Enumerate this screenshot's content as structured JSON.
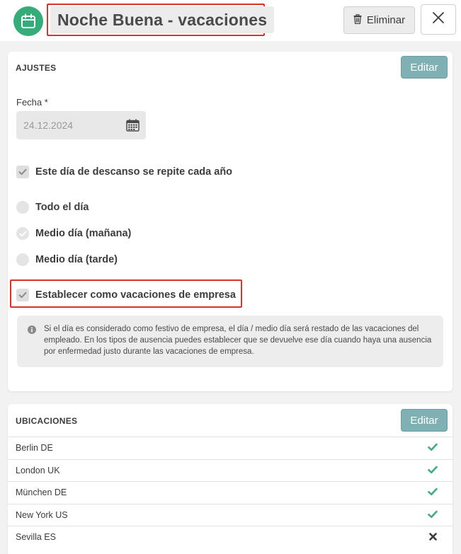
{
  "header": {
    "app_icon": "calendar-icon",
    "title": "Noche Buena - vacaciones",
    "delete_label": "Eliminar",
    "delete_icon": "trash-icon",
    "close_icon": "close-icon"
  },
  "ajustes": {
    "section_title": "AJUSTES",
    "edit_label": "Editar",
    "date_label": "Fecha *",
    "date_value": "24.12.2024",
    "date_icon": "calendar-icon",
    "repeat_label": "Este día de descanso se repite cada año",
    "repeat_checked": true,
    "duration_options": [
      {
        "label": "Todo el día",
        "selected": false
      },
      {
        "label": "Medio día (mañana)",
        "selected": true
      },
      {
        "label": "Medio día (tarde)",
        "selected": false
      }
    ],
    "company_holiday_label": "Establecer como vacaciones de empresa",
    "company_holiday_checked": true,
    "info_text": "Si el día es considerado como festivo de empresa, el día / medio día será restado de las vacaciones del empleado. En los tipos de ausencia puedes establecer que se devuelve ese día cuando haya una ausencia por enfermedad justo durante las vacaciones de empresa."
  },
  "ubicaciones": {
    "section_title": "UBICACIONES",
    "edit_label": "Editar",
    "locations": [
      {
        "name": "Berlin DE",
        "active": true
      },
      {
        "name": "London UK",
        "active": true
      },
      {
        "name": "München DE",
        "active": true
      },
      {
        "name": "New York US",
        "active": true
      },
      {
        "name": "Sevilla ES",
        "active": false
      }
    ]
  },
  "colors": {
    "brand_green": "#35ad7a",
    "check_green": "#3fae7c",
    "edit_button": "#7fb0b3",
    "highlight_red": "#d9342b"
  }
}
